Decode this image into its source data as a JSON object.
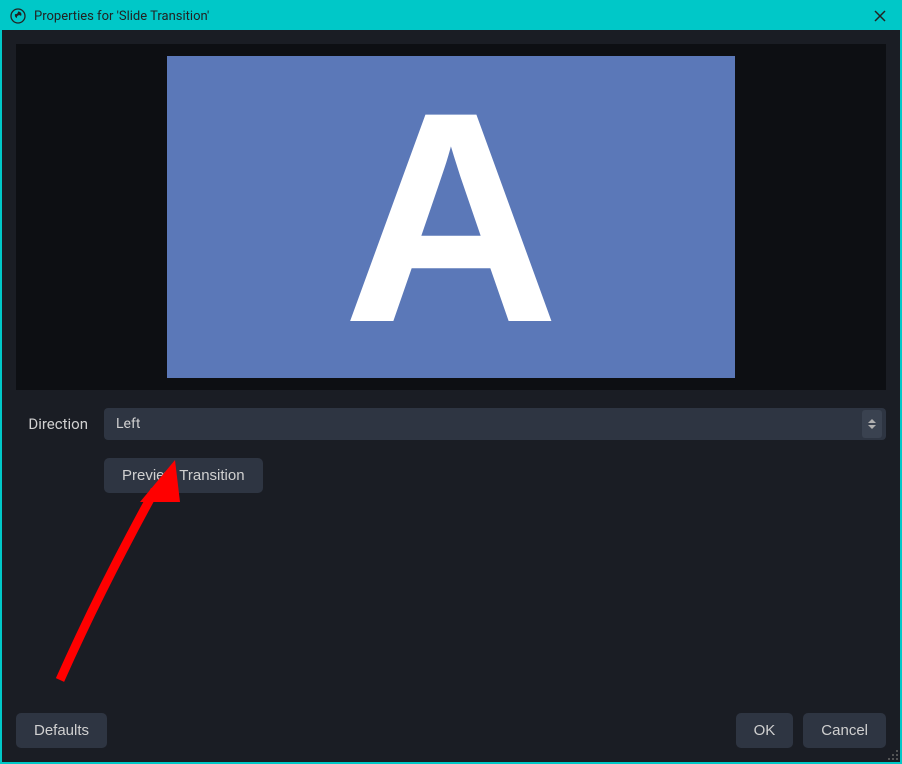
{
  "titlebar": {
    "title": "Properties for 'Slide Transition'"
  },
  "preview": {
    "letter": "A"
  },
  "form": {
    "direction_label": "Direction",
    "direction_value": "Left"
  },
  "buttons": {
    "preview": "Preview Transition",
    "defaults": "Defaults",
    "ok": "OK",
    "cancel": "Cancel"
  },
  "colors": {
    "accent": "#00c8c8",
    "canvas": "#5b78b8",
    "annotation": "#ff0000"
  }
}
